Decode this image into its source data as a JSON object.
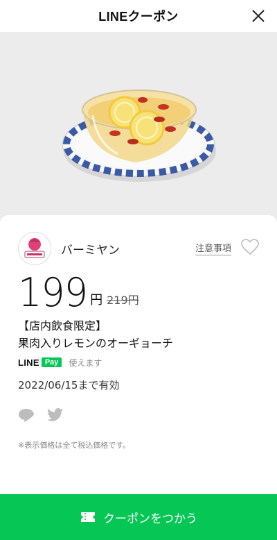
{
  "header": {
    "title": "LINEクーポン"
  },
  "coupon": {
    "brand": "バーミヤン",
    "notes_link": "注意事項",
    "price": "199",
    "price_unit": "円",
    "original_price": "219円",
    "tag": "【店内飲食限定】",
    "title": "果肉入りレモンのオーギョーチ",
    "pay_brand": "LINE",
    "pay_badge": "Pay",
    "pay_usable": "使えます",
    "expiry": "2022/06/15まで有効",
    "tax_note": "※表示価格は全て税込価格です。"
  },
  "actions": {
    "use_button": "クーポンをつかう"
  },
  "colors": {
    "accent": "#06c755",
    "hero_bg": "#ececec"
  }
}
